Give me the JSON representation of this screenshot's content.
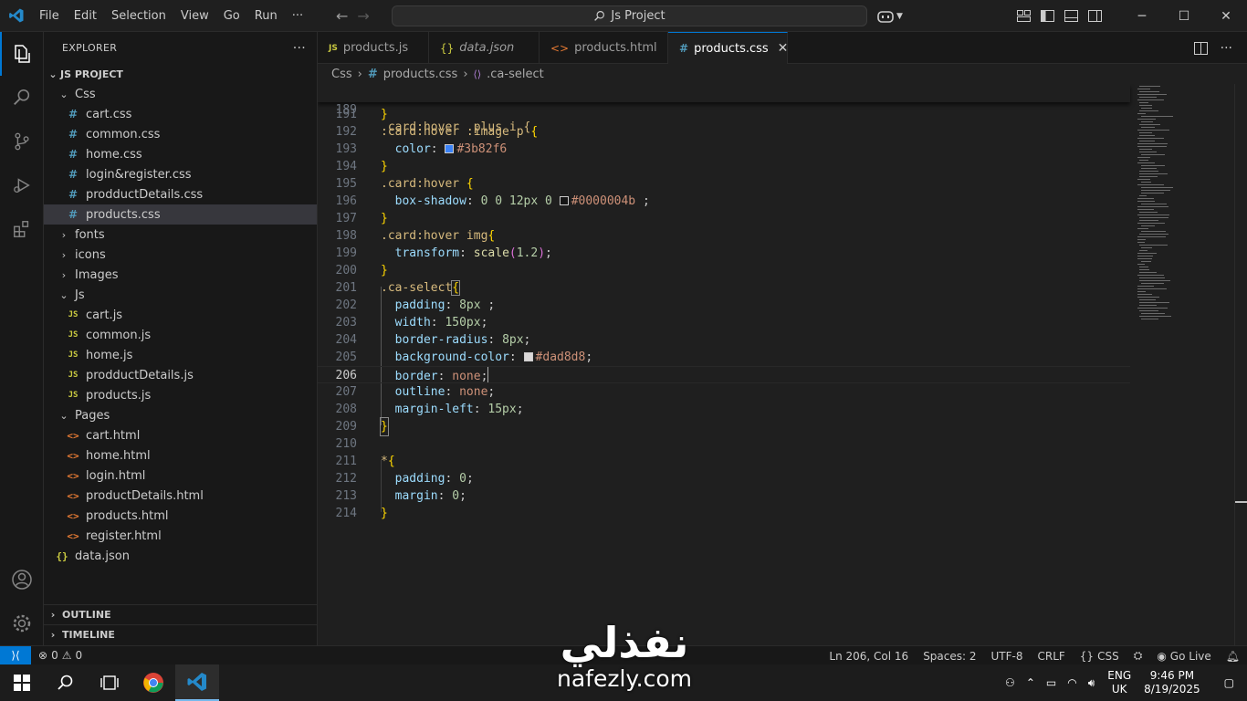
{
  "titlebar": {
    "menu": [
      "File",
      "Edit",
      "Selection",
      "View",
      "Go",
      "Run",
      "···"
    ],
    "search_text": "Js Project"
  },
  "sidebar": {
    "header": "EXPLORER",
    "more": "···",
    "project": "JS PROJECT",
    "css_folder": "Css",
    "css_files": [
      "cart.css",
      "common.css",
      "home.css",
      "login&register.css",
      "prodductDetails.css",
      "products.css"
    ],
    "fonts_folder": "fonts",
    "icons_folder": "icons",
    "images_folder": "Images",
    "js_folder": "Js",
    "js_files": [
      "cart.js",
      "common.js",
      "home.js",
      "prodductDetails.js",
      "products.js"
    ],
    "pages_folder": "Pages",
    "html_files": [
      "cart.html",
      "home.html",
      "login.html",
      "productDetails.html",
      "products.html",
      "register.html"
    ],
    "json_file": "data.json",
    "outline": "OUTLINE",
    "timeline": "TIMELINE"
  },
  "tabs": [
    {
      "label": "products.js",
      "icon": "JS"
    },
    {
      "label": "data.json",
      "icon": "{}"
    },
    {
      "label": "products.html",
      "icon": "<>"
    },
    {
      "label": "products.css",
      "icon": "#"
    }
  ],
  "breadcrumb": {
    "folder": "Css",
    "file": "products.css",
    "symbol": ".ca-select"
  },
  "editor": {
    "line_numbers": [
      "189",
      "191",
      "192",
      "193",
      "194",
      "195",
      "196",
      "197",
      "198",
      "199",
      "200",
      "201",
      "202",
      "203",
      "204",
      "205",
      "206",
      "207",
      "208",
      "209",
      "210",
      "211",
      "212",
      "213",
      "214"
    ],
    "current_line": "206",
    "code": {
      "l189": ".card:hover .plus i {",
      "l191": "}",
      "l192_sel": ".card:hover .image p ",
      "l193_prop": "color",
      "l193_val": "#3b82f6",
      "l195_sel": ".card:hover ",
      "l196_prop": "box-shadow",
      "l196_nums": "0 0 12px 0 ",
      "l196_val": "#0000004b",
      "l196_end": " ;",
      "l198_sel": ".card:hover img",
      "l199_prop": "transform",
      "l199_fn": "scale",
      "l199_num": "1.2",
      "l201_sel": ".ca-select",
      "l202_prop": "padding",
      "l202_val": "8px",
      "l202_end": " ;",
      "l203_prop": "width",
      "l203_val": "150px",
      "l204_prop": "border-radius",
      "l204_val": "8px",
      "l205_prop": "background-color",
      "l205_val": "#dad8d8",
      "l206_prop": "border",
      "l206_val": "none",
      "l207_prop": "outline",
      "l207_val": "none",
      "l208_prop": "margin-left",
      "l208_val": "15px",
      "l211_sel": "*",
      "l212_prop": "padding",
      "l212_val": "0",
      "l213_prop": "margin",
      "l213_val": "0"
    }
  },
  "statusbar": {
    "problems": "0",
    "warnings": "0",
    "position": "Ln 206, Col 16",
    "spaces": "Spaces: 2",
    "encoding": "UTF-8",
    "eol": "CRLF",
    "language": "CSS",
    "golive": "Go Live"
  },
  "taskbar": {
    "lang_line1": "ENG",
    "lang_line2": "UK",
    "time": "9:46 PM",
    "date": "8/19/2025"
  },
  "watermark": {
    "arabic": "نفذلي",
    "latin": "nafezly.com"
  },
  "colors": {
    "accent": "#0078d4",
    "swatch_blue": "#3b82f6",
    "swatch_black": "#0000004b",
    "swatch_gray": "#dad8d8"
  }
}
